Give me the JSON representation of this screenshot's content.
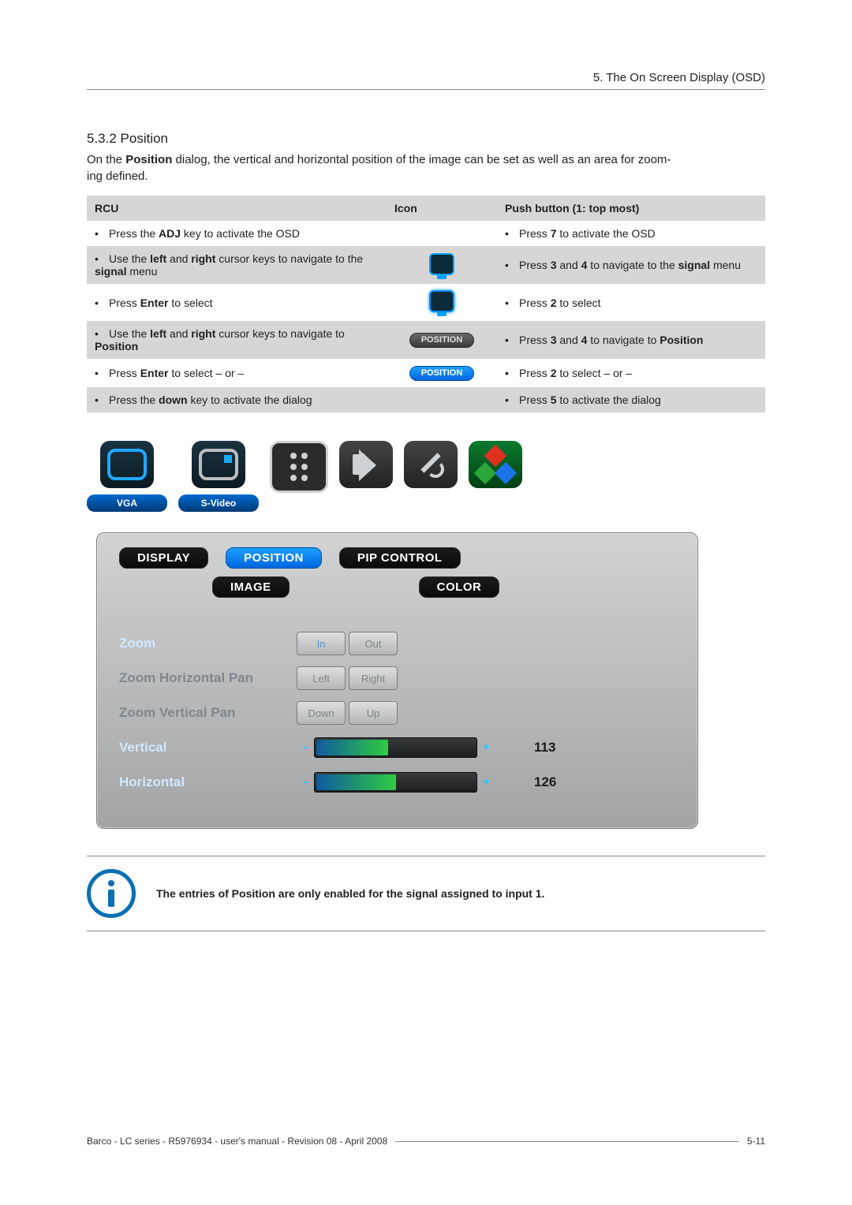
{
  "header": {
    "title": "5. The On Screen Display (OSD)"
  },
  "section": {
    "number": "5.3.2 Position",
    "para": "On the Position dialog, the vertical and horizontal position of the image can be set as well as an area for zooming defined."
  },
  "table": {
    "head": {
      "rcu": "RCU",
      "icon": "Icon",
      "push": "Push button (1: top most)"
    },
    "rows": [
      {
        "rcu_pre": "Press the ",
        "rcu_b": "ADJ",
        "rcu_post": " key to activate the OSD",
        "push_pre": "Press ",
        "push_b": "7",
        "push_post": " to activate the OSD",
        "icon": ""
      },
      {
        "rcu_pre": "Use the ",
        "rcu_b": "left",
        "rcu_mid": " and ",
        "rcu_b2": "right",
        "rcu_post": " cursor keys to navigate to the ",
        "rcu_b3": "signal",
        "rcu_end": " menu",
        "push_pre": "Press ",
        "push_b": "3",
        "push_mid": " and ",
        "push_b2": "4",
        "push_post": " to navigate to the ",
        "push_b3": "signal",
        "push_end": " menu",
        "icon": "monitor"
      },
      {
        "rcu_pre": "Press ",
        "rcu_b": "Enter",
        "rcu_post": " to select",
        "push_pre": "Press ",
        "push_b": "2",
        "push_post": " to select",
        "icon": "monitor-sel"
      },
      {
        "rcu_pre": "Use the ",
        "rcu_b": "left",
        "rcu_mid": " and ",
        "rcu_b2": "right",
        "rcu_post": " cursor keys to navigate to ",
        "rcu_b3": "Position",
        "rcu_end": "",
        "push_pre": "Press ",
        "push_b": "3",
        "push_mid": " and ",
        "push_b2": "4",
        "push_post": " to navigate to ",
        "push_b3": "Position",
        "push_end": "",
        "icon": "pill-grey",
        "icon_label": "POSITION"
      },
      {
        "rcu_pre": "Press ",
        "rcu_b": "Enter",
        "rcu_post": " to select – or –",
        "push_pre": "Press ",
        "push_b": "2",
        "push_post": " to select – or –",
        "icon": "pill-blue",
        "icon_label": "POSITION"
      },
      {
        "rcu_pre": "Press the ",
        "rcu_b": "down",
        "rcu_post": " key to activate the dialog",
        "push_pre": "Press ",
        "push_b": "5",
        "push_post": " to activate the dialog",
        "icon": ""
      }
    ]
  },
  "tabs": {
    "items": [
      {
        "label": "VGA"
      },
      {
        "label": "S-Video"
      }
    ]
  },
  "osd": {
    "top_tabs": [
      "DISPLAY",
      "POSITION",
      "PIP CONTROL"
    ],
    "sub_tabs": [
      "IMAGE",
      "COLOR"
    ],
    "rows": [
      {
        "label": "Zoom",
        "hl": true,
        "type": "seg",
        "buttons": [
          "In",
          "Out"
        ],
        "active": 0
      },
      {
        "label": "Zoom Horizontal Pan",
        "hl": false,
        "type": "seg",
        "buttons": [
          "Left",
          "Right"
        ]
      },
      {
        "label": "Zoom Vertical Pan",
        "hl": false,
        "type": "seg",
        "buttons": [
          "Down",
          "Up"
        ]
      },
      {
        "label": "Vertical",
        "hl": true,
        "type": "bar",
        "value": 113,
        "max": 255,
        "color_from": "#0e5aa0",
        "color_to": "#2ecc40"
      },
      {
        "label": "Horizontal",
        "hl": true,
        "type": "bar",
        "value": 126,
        "max": 255,
        "color_from": "#0e5aa0",
        "color_to": "#2ecc40"
      }
    ]
  },
  "info": {
    "text": "The entries of Position are only enabled for the signal assigned to input 1."
  },
  "footer": {
    "left": "Barco - LC series - R5976934 - user's manual - Revision 08 - April 2008",
    "right": "5-11"
  },
  "chart_data": {
    "type": "table",
    "title": "OSD Position sliders",
    "series": [
      {
        "name": "Vertical",
        "values": [
          113
        ]
      },
      {
        "name": "Horizontal",
        "values": [
          126
        ]
      }
    ],
    "ylim": [
      0,
      255
    ]
  }
}
